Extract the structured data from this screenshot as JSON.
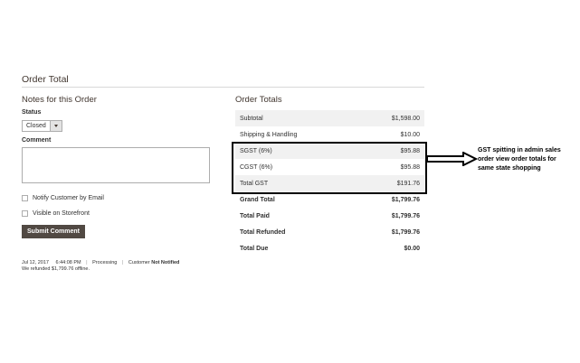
{
  "section": {
    "title": "Order Total"
  },
  "notes": {
    "title": "Notes for this Order",
    "status_label": "Status",
    "status_value": "Closed",
    "comment_label": "Comment",
    "comment_value": "",
    "notify_label": "Notify Customer by Email",
    "visible_label": "Visible on Storefront",
    "submit_label": "Submit Comment"
  },
  "history": {
    "date": "Jul 12, 2017",
    "time": "6:44:08 PM",
    "status": "Processing",
    "customer_label": "Customer",
    "customer_value": "Not Notified",
    "message": "We refunded $1,799.76 offline."
  },
  "totals": {
    "title": "Order Totals",
    "rows": [
      {
        "label": "Subtotal",
        "value": "$1,598.00",
        "shaded": true,
        "bold": false
      },
      {
        "label": "Shipping & Handling",
        "value": "$10.00",
        "shaded": false,
        "bold": false
      },
      {
        "label": "SGST (6%)",
        "value": "$95.88",
        "shaded": true,
        "bold": false
      },
      {
        "label": "CGST (6%)",
        "value": "$95.88",
        "shaded": false,
        "bold": false
      },
      {
        "label": "Total GST",
        "value": "$191.76",
        "shaded": true,
        "bold": false
      },
      {
        "label": "Grand Total",
        "value": "$1,799.76",
        "shaded": false,
        "bold": true
      },
      {
        "label": "Total Paid",
        "value": "$1,799.76",
        "shaded": false,
        "bold": true
      },
      {
        "label": "Total Refunded",
        "value": "$1,799.76",
        "shaded": false,
        "bold": true
      },
      {
        "label": "Total Due",
        "value": "$0.00",
        "shaded": false,
        "bold": true
      }
    ]
  },
  "annotation": {
    "lines": [
      "GST spitting in admin sales",
      "order view order totals for",
      "same state shopping"
    ]
  },
  "colors": {
    "button_bg": "#514943",
    "row_shade": "#f1f1f1",
    "highlight_border": "#000000"
  }
}
